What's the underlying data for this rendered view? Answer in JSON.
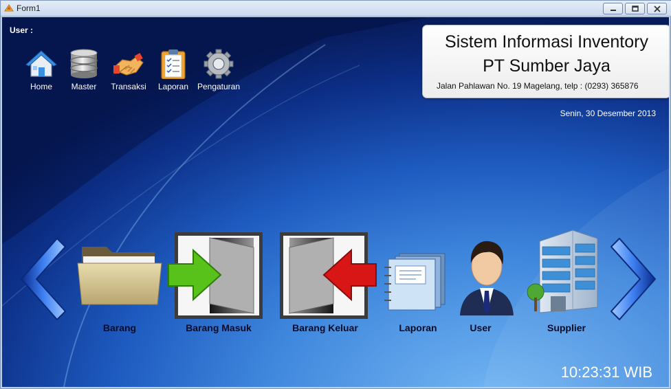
{
  "window": {
    "title": "Form1"
  },
  "header": {
    "user_label": "User :"
  },
  "top_menu": [
    {
      "label": "Home",
      "icon": "home-icon"
    },
    {
      "label": "Master",
      "icon": "database-icon"
    },
    {
      "label": "Transaksi",
      "icon": "handshake-icon"
    },
    {
      "label": "Laporan",
      "icon": "clipboard-icon"
    },
    {
      "label": "Pengaturan",
      "icon": "gear-icon"
    }
  ],
  "info": {
    "system_name": "Sistem Informasi Inventory",
    "company": "PT Sumber Jaya",
    "address": "Jalan Pahlawan No. 19 Magelang, telp : (0293) 365876"
  },
  "date": "Senin, 30 Desember 2013",
  "main_menu": [
    {
      "label": "Barang",
      "icon": "folder-icon"
    },
    {
      "label": "Barang Masuk",
      "icon": "door-in-icon"
    },
    {
      "label": "Barang Keluar",
      "icon": "door-out-icon"
    },
    {
      "label": "Laporan",
      "icon": "notebook-icon"
    },
    {
      "label": "User",
      "icon": "user-icon"
    },
    {
      "label": "Supplier",
      "icon": "building-icon"
    }
  ],
  "clock": "10:23:31 WIB",
  "colors": {
    "accent": "#1e5bc0",
    "arrow_in": "#58c21a",
    "arrow_out": "#d81616"
  }
}
